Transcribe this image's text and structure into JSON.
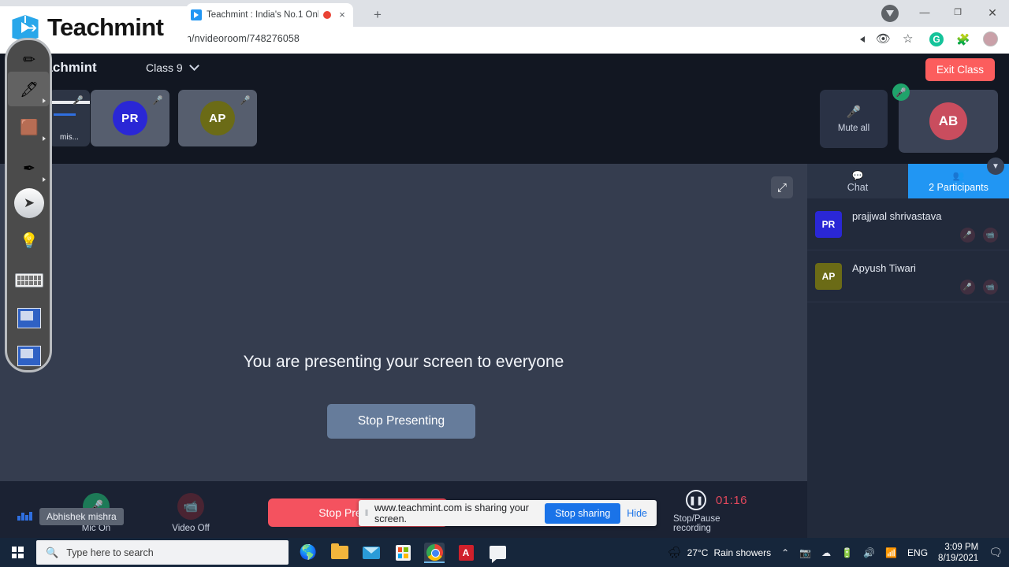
{
  "browser": {
    "tab": {
      "title": "Teachmint : India's No.1 Onli",
      "favicon": "teachmint-favicon",
      "recording_indicator": "recording-dot",
      "close": "×"
    },
    "new_tab": "+",
    "window_controls": {
      "minimize": "—",
      "maximize": "❐",
      "close": "✕"
    },
    "url": "n/nvideoroom/748276058",
    "omnibox_icons": [
      "camera-icon",
      "eye-off-icon",
      "bookmark-star-icon",
      "grammarly-icon",
      "extensions-puzzle-icon",
      "profile-avatar"
    ],
    "grammarly_letter": "G"
  },
  "logo_overlay": {
    "word": "Teachmint"
  },
  "app": {
    "brand": "eachmint",
    "class_label": "Class 9",
    "exit_label": "Exit Class",
    "tiles": [
      {
        "type": "shared-thumb",
        "label": "mis...",
        "mic": "mic-off-icon"
      },
      {
        "type": "avatar",
        "initials": "PR",
        "mic": "mic-off-icon"
      },
      {
        "type": "avatar",
        "initials": "AP",
        "mic": "mic-off-icon"
      }
    ],
    "mute_all": {
      "label": "Mute all",
      "icon": "mic-off-icon"
    },
    "self_tile": {
      "initials": "AB",
      "mic_status": "mic-on-icon"
    },
    "stage": {
      "message": "You are presenting your screen to everyone",
      "stop_presenting": "Stop Presenting",
      "expand_icon": "expand-arrows-icon"
    },
    "controls": {
      "mic": {
        "label": "Mic On",
        "icon": "microphone-icon"
      },
      "video": {
        "label": "Video Off",
        "icon": "video-off-icon"
      },
      "stop_present": "Stop Presenting",
      "recording": {
        "label": "Stop/Pause recording",
        "time": "01:16",
        "icon": "pause-icon"
      },
      "self_tooltip": "Abhishek mishra"
    }
  },
  "panel": {
    "tabs": [
      {
        "label": "Chat",
        "icon": "chat-bubble-icon",
        "active": false
      },
      {
        "label": "2 Participants",
        "icon": "people-icon",
        "active": true
      }
    ],
    "collapse_icon": "chevron-down-icon",
    "participants": [
      {
        "initials": "PR",
        "name": "prajjwal shrivastava",
        "mic": "mic-off-icon",
        "cam": "camera-off-icon"
      },
      {
        "initials": "AP",
        "name": "Apyush Tiwari",
        "mic": "mic-off-icon",
        "cam": "camera-off-icon"
      }
    ]
  },
  "share_notification": {
    "grip": "‖",
    "text": "www.teachmint.com is sharing your screen.",
    "stop_label": "Stop sharing",
    "hide_label": "Hide"
  },
  "ink_toolbar": {
    "tools": [
      {
        "name": "pen-tool",
        "glyph": "✒",
        "selected": true
      },
      {
        "name": "eraser-tool",
        "glyph": "⌫",
        "selected": false
      },
      {
        "name": "highlighter-tool",
        "glyph": "✍",
        "selected": false
      },
      {
        "name": "select-cursor-tool",
        "glyph": "➤",
        "selected": false
      },
      {
        "name": "laser-pointer-tool",
        "glyph": "╱",
        "selected": false
      },
      {
        "name": "on-screen-keyboard-tool",
        "glyph": "",
        "selected": false
      },
      {
        "name": "whiteboard-tool",
        "glyph": "",
        "selected": false
      },
      {
        "name": "screen-capture-tool",
        "glyph": "",
        "selected": false
      }
    ]
  },
  "taskbar": {
    "start": "windows-logo-icon",
    "search_placeholder": "Type here to search",
    "apps": [
      "edge-icon",
      "file-explorer-icon",
      "mail-icon",
      "microsoft-store-icon",
      "chrome-icon",
      "adobe-reader-icon",
      "chat-icon"
    ],
    "tray": {
      "weather_temp": "27°C",
      "weather_desc": "Rain showers",
      "overflow": "⌃",
      "icons": [
        "camera-tray-icon",
        "onedrive-icon",
        "battery-icon",
        "volume-icon",
        "wifi-icon"
      ],
      "language": "ENG",
      "time": "3:09 PM",
      "date": "8/19/2021",
      "notifications": "action-center-icon"
    }
  }
}
